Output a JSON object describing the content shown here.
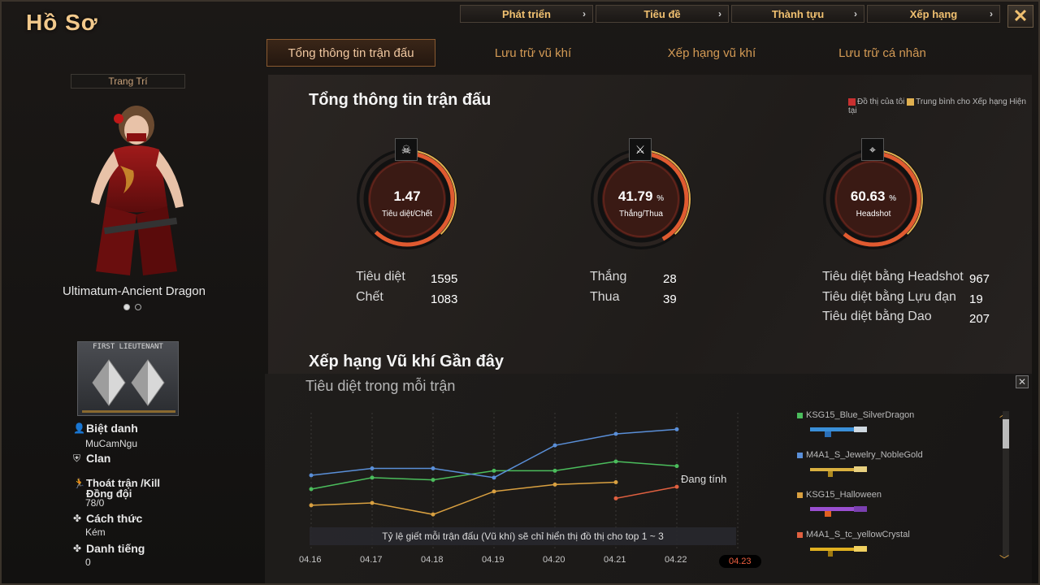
{
  "header": {
    "title": "Hồ Sơ"
  },
  "topnav": [
    {
      "label": "Phát triển"
    },
    {
      "label": "Tiêu đề"
    },
    {
      "label": "Thành tựu"
    },
    {
      "label": "Xếp hạng"
    }
  ],
  "tabs": [
    {
      "label": "Tổng thông tin trận đấu",
      "active": true
    },
    {
      "label": "Lưu trữ vũ khí"
    },
    {
      "label": "Xếp hạng vũ khí"
    },
    {
      "label": "Lưu trữ cá nhân"
    }
  ],
  "left": {
    "deco_label": "Trang Trí",
    "character_name": "Ultimatum-Ancient Dragon",
    "rank_text": "FIRST LIEUTENANT",
    "nickname_label": "Biệt danh",
    "nickname": "MuCamNgu",
    "clan_label": "Clan",
    "escape_label": "Thoát trận /Kill Đồng đội",
    "escape_value": "78/0",
    "style_label": "Cách thức",
    "style_value": "Kém",
    "reputation_label": "Danh tiếng",
    "reputation_value": "0"
  },
  "summary": {
    "title": "Tổng thông tin trận đấu",
    "legend_mine": "Đồ thị của tôi",
    "legend_avg": "Trung bình cho Xếp hạng Hiện tại",
    "rings": [
      {
        "value": "1.47",
        "pct": "",
        "label": "Tiêu diệt/Chết",
        "icon": "☠",
        "fill": 0.62
      },
      {
        "value": "41.79",
        "pct": "%",
        "label": "Thắng/Thua",
        "icon": "⚔",
        "fill": 0.42
      },
      {
        "value": "60.63",
        "pct": "%",
        "label": "Headshot",
        "icon": "⌖",
        "fill": 0.61
      }
    ],
    "kills_label": "Tiêu diệt",
    "kills": "1595",
    "deaths_label": "Chết",
    "deaths": "1083",
    "wins_label": "Thắng",
    "wins": "28",
    "losses_label": "Thua",
    "losses": "39",
    "hs_kills_label": "Tiêu diệt bằng Headshot",
    "hs_kills": "967",
    "grenade_kills_label": "Tiêu diệt bằng Lựu đạn",
    "grenade_kills": "19",
    "knife_kills_label": "Tiêu diệt bằng Dao",
    "knife_kills": "207"
  },
  "recent": {
    "title": "Xếp hạng Vũ khí Gần đây",
    "chart_title": "Tiêu diệt trong mỗi trận",
    "note": "Tỷ lệ giết mỗi trận đấu (Vũ khí) sẽ chỉ hiển thị đồ thị cho top 1 ~ 3",
    "calculating": "Đang tính",
    "weapons": [
      {
        "name": "KSG15_Blue_SilverDragon",
        "color": "#4bbd5c",
        "gun": "#3a8fd8"
      },
      {
        "name": "M4A1_S_Jewelry_NobleGold",
        "color": "#5a8fd8",
        "gun": "#d9b040"
      },
      {
        "name": "KSG15_Halloween",
        "color": "#d9a040",
        "gun": "#9a4fd0"
      },
      {
        "name": "M4A1_S_tc_yellowCrystal",
        "color": "#e06040",
        "gun": "#e0b020"
      }
    ]
  },
  "chart_data": {
    "type": "line",
    "title": "Tiêu diệt trong mỗi trận",
    "categories": [
      "04.16",
      "04.17",
      "04.18",
      "04.19",
      "04.20",
      "04.21",
      "04.22",
      "04.23"
    ],
    "active_category": "04.23",
    "series": [
      {
        "name": "KSG15_Blue_SilverDragon",
        "color": "#4bbd5c",
        "values": [
          2.4,
          2.9,
          2.8,
          3.2,
          3.2,
          3.6,
          3.4,
          null
        ]
      },
      {
        "name": "M4A1_S_Jewelry_NobleGold",
        "color": "#5a8fd8",
        "values": [
          3.0,
          3.3,
          3.3,
          2.9,
          4.3,
          4.8,
          5.0,
          null
        ]
      },
      {
        "name": "KSG15_Halloween",
        "color": "#d9a040",
        "values": [
          1.7,
          1.8,
          1.3,
          2.3,
          2.6,
          2.7,
          null,
          null
        ]
      },
      {
        "name": "M4A1_S_tc_yellowCrystal",
        "color": "#e06040",
        "values": [
          null,
          null,
          null,
          null,
          null,
          2.0,
          2.5,
          null
        ]
      }
    ],
    "ylim": [
      0,
      6
    ]
  }
}
